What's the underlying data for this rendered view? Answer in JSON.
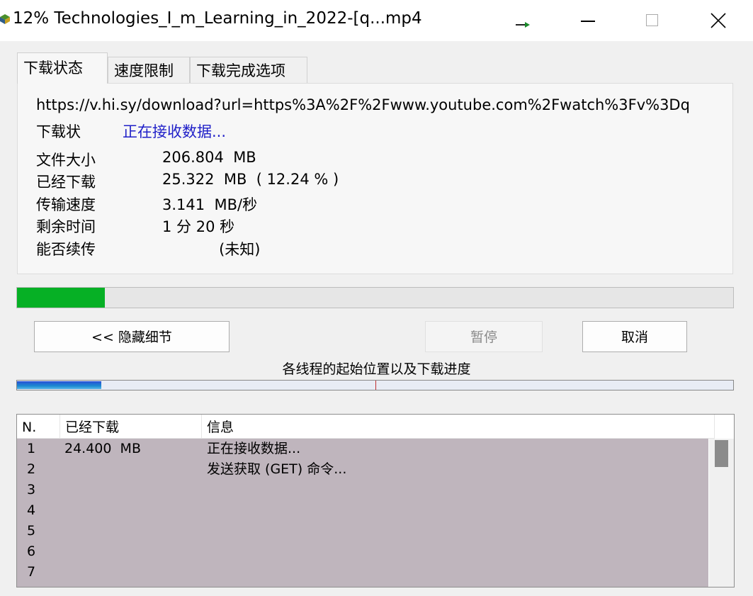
{
  "window": {
    "title": "12% Technologies_I_m_Learning_in_2022-[q...mp4"
  },
  "tabs": [
    {
      "label": "下载状态",
      "active": true
    },
    {
      "label": "速度限制",
      "active": false
    },
    {
      "label": "下载完成选项",
      "active": false
    }
  ],
  "status": {
    "url": "https://v.hi.sy/download?url=https%3A%2F%2Fwww.youtube.com%2Fwatch%3Fv%3Dq",
    "status_label": "下载状",
    "status_value": "正在接收数据...",
    "status_color": "#2020c8",
    "rows": [
      {
        "label": "文件大小",
        "value": "206.804  MB"
      },
      {
        "label": "已经下载",
        "value": "25.322  MB  ( 12.24 % )"
      },
      {
        "label": "传输速度",
        "value": "3.141  MB/秒"
      },
      {
        "label": "剩余时间",
        "value": "1 分 20 秒"
      },
      {
        "label": "能否续传",
        "value": "            (未知)"
      }
    ]
  },
  "progress": {
    "fraction": 0.1224,
    "color": "#06b025"
  },
  "buttons": {
    "details": "<< 隐藏细节",
    "pause": "暂停",
    "cancel": "取消"
  },
  "threads": {
    "caption": "各线程的起始位置以及下载进度",
    "segments": [
      {
        "start": 0.0,
        "end": 0.5,
        "progress": 0.236
      },
      {
        "start": 0.5,
        "end": 1.0,
        "progress": 0.0
      }
    ]
  },
  "connections": {
    "columns": [
      "N.",
      "已经下载",
      "信息"
    ],
    "rows": [
      {
        "n": "1",
        "downloaded": "24.400  MB",
        "info": "正在接收数据..."
      },
      {
        "n": "2",
        "downloaded": "",
        "info": "发送获取 (GET) 命令..."
      },
      {
        "n": "3",
        "downloaded": "",
        "info": ""
      },
      {
        "n": "4",
        "downloaded": "",
        "info": ""
      },
      {
        "n": "5",
        "downloaded": "",
        "info": ""
      },
      {
        "n": "6",
        "downloaded": "",
        "info": ""
      },
      {
        "n": "7",
        "downloaded": "",
        "info": ""
      }
    ]
  },
  "icons": [
    "app-icon",
    "arrow-icon",
    "minimize-icon",
    "maximize-icon",
    "close-icon"
  ]
}
